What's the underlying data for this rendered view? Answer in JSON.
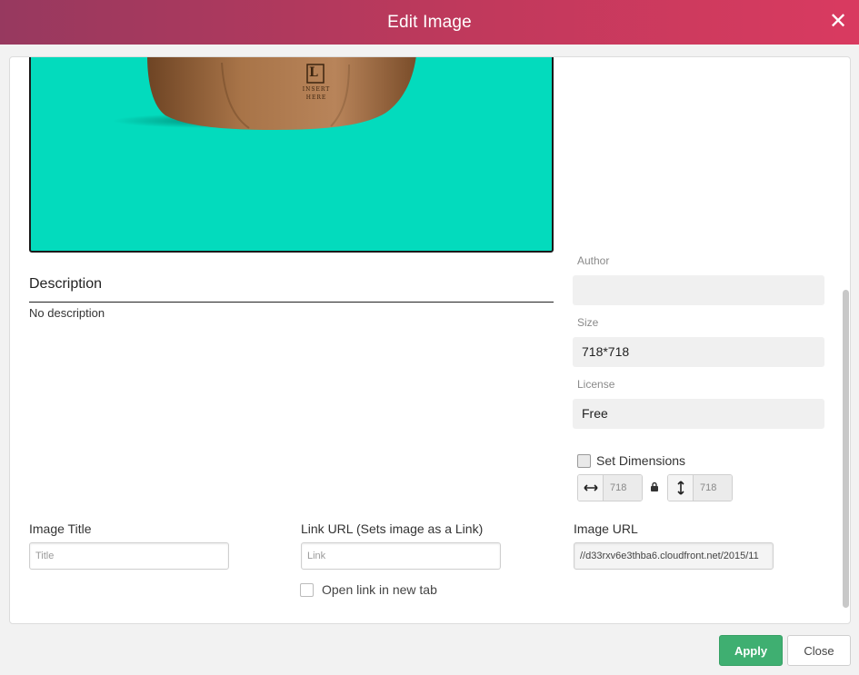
{
  "dialog": {
    "title": "Edit Image"
  },
  "preview": {
    "background_color": "#03dbbd",
    "logo_letter": "L",
    "logo_text": "INSERT HERE"
  },
  "description": {
    "heading": "Description",
    "text": "No description"
  },
  "metadata": {
    "author_label": "Author",
    "author_value": "",
    "size_label": "Size",
    "size_value": "718*718",
    "license_label": "License",
    "license_value": "Free"
  },
  "dimensions": {
    "checkbox_label": "Set Dimensions",
    "checked": false,
    "width_value": "718",
    "height_value": "718"
  },
  "fields": {
    "image_title_label": "Image Title",
    "image_title_placeholder": "Title",
    "link_url_label": "Link URL (Sets image as a Link)",
    "link_url_placeholder": "Link",
    "new_tab_label": "Open link in new tab",
    "image_url_label": "Image URL",
    "image_url_value": "//d33rxv6e3thba6.cloudfront.net/2015/11"
  },
  "buttons": {
    "apply": "Apply",
    "close": "Close"
  },
  "colors": {
    "header_start": "#97395f",
    "header_end": "#d93a60",
    "apply_green": "#3faf71"
  }
}
